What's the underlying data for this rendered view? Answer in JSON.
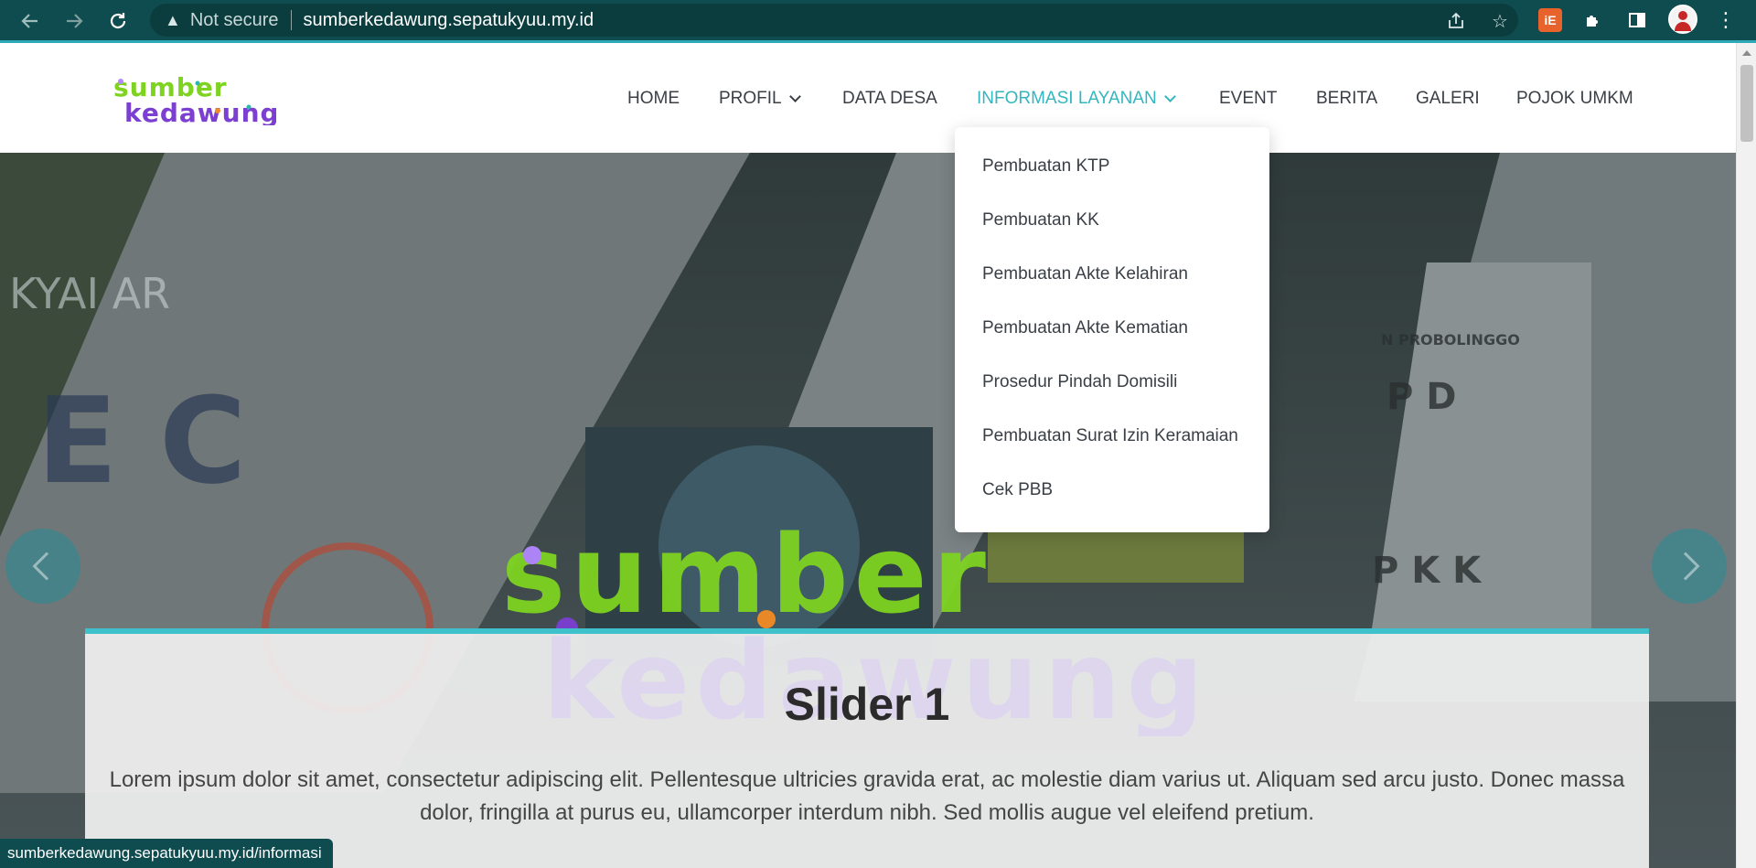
{
  "browser": {
    "security_label": "Not secure",
    "url": "sumberkedawung.sepatukyuu.my.id",
    "status_url": "sumberkedawung.sepatukyuu.my.id/informasi",
    "extension_label": "iE",
    "icons": [
      "back-icon",
      "forward-icon",
      "reload-icon",
      "warning-icon",
      "share-icon",
      "star-icon",
      "puzzle-icon",
      "sidebar-icon",
      "profile-avatar",
      "menu-dots-icon"
    ]
  },
  "site": {
    "logo_alt": "sumber kedawung",
    "logo_colors": {
      "green": "#7ed321",
      "teal": "#2bb8a8",
      "purple": "#7b3fd1",
      "orange": "#f28b24"
    },
    "nav": [
      {
        "label": "HOME",
        "has_dropdown": false,
        "active": false
      },
      {
        "label": "PROFIL",
        "has_dropdown": true,
        "active": false
      },
      {
        "label": "DATA DESA",
        "has_dropdown": false,
        "active": false
      },
      {
        "label": "INFORMASI LAYANAN",
        "has_dropdown": true,
        "active": true
      },
      {
        "label": "EVENT",
        "has_dropdown": false,
        "active": false
      },
      {
        "label": "BERITA",
        "has_dropdown": false,
        "active": false
      },
      {
        "label": "GALERI",
        "has_dropdown": false,
        "active": false
      },
      {
        "label": "POJOK UMKM",
        "has_dropdown": false,
        "active": false
      }
    ],
    "dropdown": [
      "Pembuatan KTP",
      "Pembuatan KK",
      "Pembuatan Akte Kelahiran",
      "Pembuatan Akte Kematian",
      "Prosedur Pindah Domisili",
      "Pembuatan Surat Izin Keramaian",
      "Cek PBB"
    ]
  },
  "hero": {
    "slide_title": "Slider 1",
    "slide_text": "Lorem ipsum dolor sit amet, consectetur adipiscing elit. Pellentesque ultricies gravida erat, ac molestie diam varius ut. Aliquam sed arcu justo. Donec massa dolor, fringilla at purus eu, ullamcorper interdum nibh. Sed mollis augue vel eleifend pretium."
  },
  "colors": {
    "chrome": "#0f4c4f",
    "accent": "#34b6bf",
    "nav_text": "#3a3f46"
  }
}
